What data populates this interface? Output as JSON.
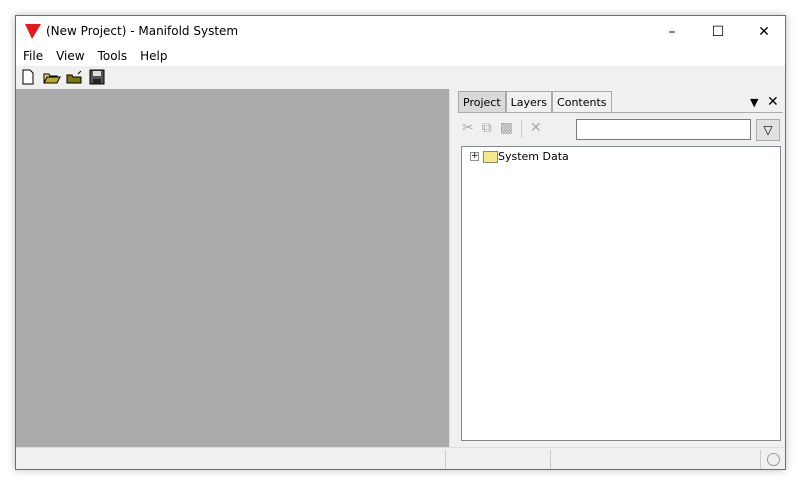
{
  "window": {
    "title": "(New Project) - Manifold System",
    "controls": [
      "minimize",
      "maximize",
      "close"
    ]
  },
  "menu": [
    "File",
    "View",
    "Tools",
    "Help"
  ],
  "toolbar": [
    "new-icon",
    "open-icon",
    "open-folder-icon",
    "save-icon"
  ],
  "panel": {
    "tabs": [
      "Project",
      "Layers",
      "Contents"
    ],
    "active_tab": "Project",
    "search": {
      "value": "",
      "placeholder": ""
    },
    "tree": [
      {
        "label": "System Data",
        "expanded": false
      }
    ]
  }
}
